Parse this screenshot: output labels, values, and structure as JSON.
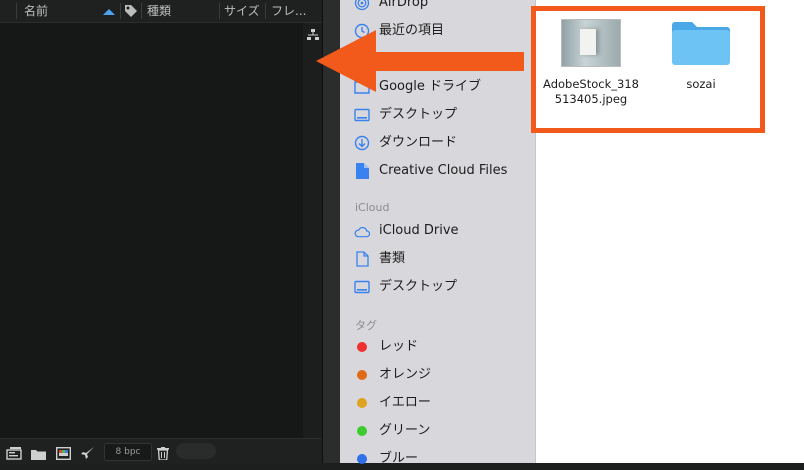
{
  "ae_panel": {
    "columns": {
      "name": "名前",
      "type": "種類",
      "size": "サイズ",
      "frame": "フレ..."
    },
    "footer": {
      "bpc": "8 bpc"
    }
  },
  "finder": {
    "sidebar": {
      "top_items": [
        {
          "label": "AirDrop",
          "icon": "airdrop-icon"
        },
        {
          "label": "最近の項目",
          "icon": "clock-icon"
        },
        {
          "label": "Google ドライブ",
          "icon": "folder-icon"
        },
        {
          "label": "デスクトップ",
          "icon": "desktop-icon"
        },
        {
          "label": "ダウンロード",
          "icon": "download-icon"
        },
        {
          "label": "Creative Cloud Files",
          "icon": "document-icon"
        }
      ],
      "icloud_section": "iCloud",
      "icloud_items": [
        {
          "label": "iCloud Drive",
          "icon": "cloud-icon"
        },
        {
          "label": "書類",
          "icon": "document-icon"
        },
        {
          "label": "デスクトップ",
          "icon": "desktop-icon"
        }
      ],
      "tags_section": "タグ",
      "tags": [
        {
          "label": "レッド",
          "color": "#f0302e"
        },
        {
          "label": "オレンジ",
          "color": "#e16a16"
        },
        {
          "label": "イエロー",
          "color": "#dfa21f"
        },
        {
          "label": "グリーン",
          "color": "#3ecb2e"
        },
        {
          "label": "ブルー",
          "color": "#2f6fe8"
        }
      ]
    },
    "files": [
      {
        "name_line1": "AdobeStock_318",
        "name_line2": "513405.jpeg",
        "icon": "image-thumbnail-icon"
      },
      {
        "name_line1": "sozai",
        "icon": "folder-icon"
      }
    ]
  },
  "colors": {
    "annotation_accent": "#f25a1c",
    "folder_blue": "#5fbbf0"
  }
}
